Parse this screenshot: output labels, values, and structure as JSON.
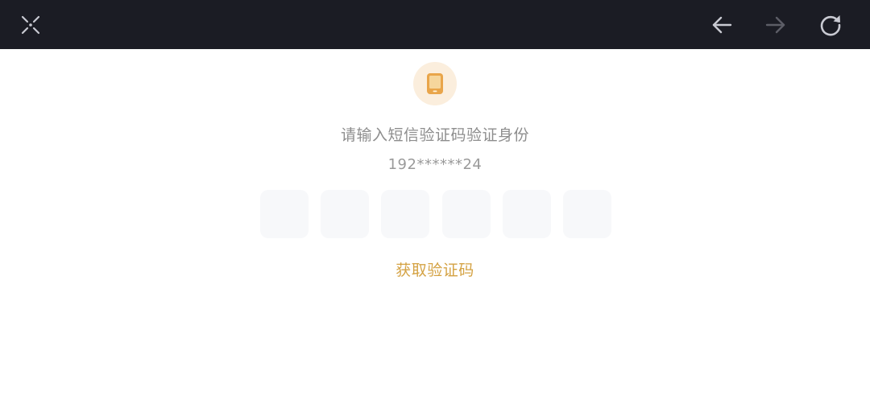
{
  "topbar": {
    "close_icon": "close-icon",
    "back_icon": "arrow-left-icon",
    "forward_icon": "arrow-right-icon",
    "refresh_icon": "refresh-icon"
  },
  "verify": {
    "phone_icon": "mobile-phone-icon",
    "prompt": "请输入短信验证码验证身份",
    "phone_number": "192******24",
    "code_boxes": [
      "",
      "",
      "",
      "",
      "",
      ""
    ],
    "get_code_label": "获取验证码"
  },
  "colors": {
    "topbar_bg": "#1b1c24",
    "accent": "#d4a243",
    "badge_bg": "#fbeedd",
    "input_bg": "#f7f8fa"
  }
}
